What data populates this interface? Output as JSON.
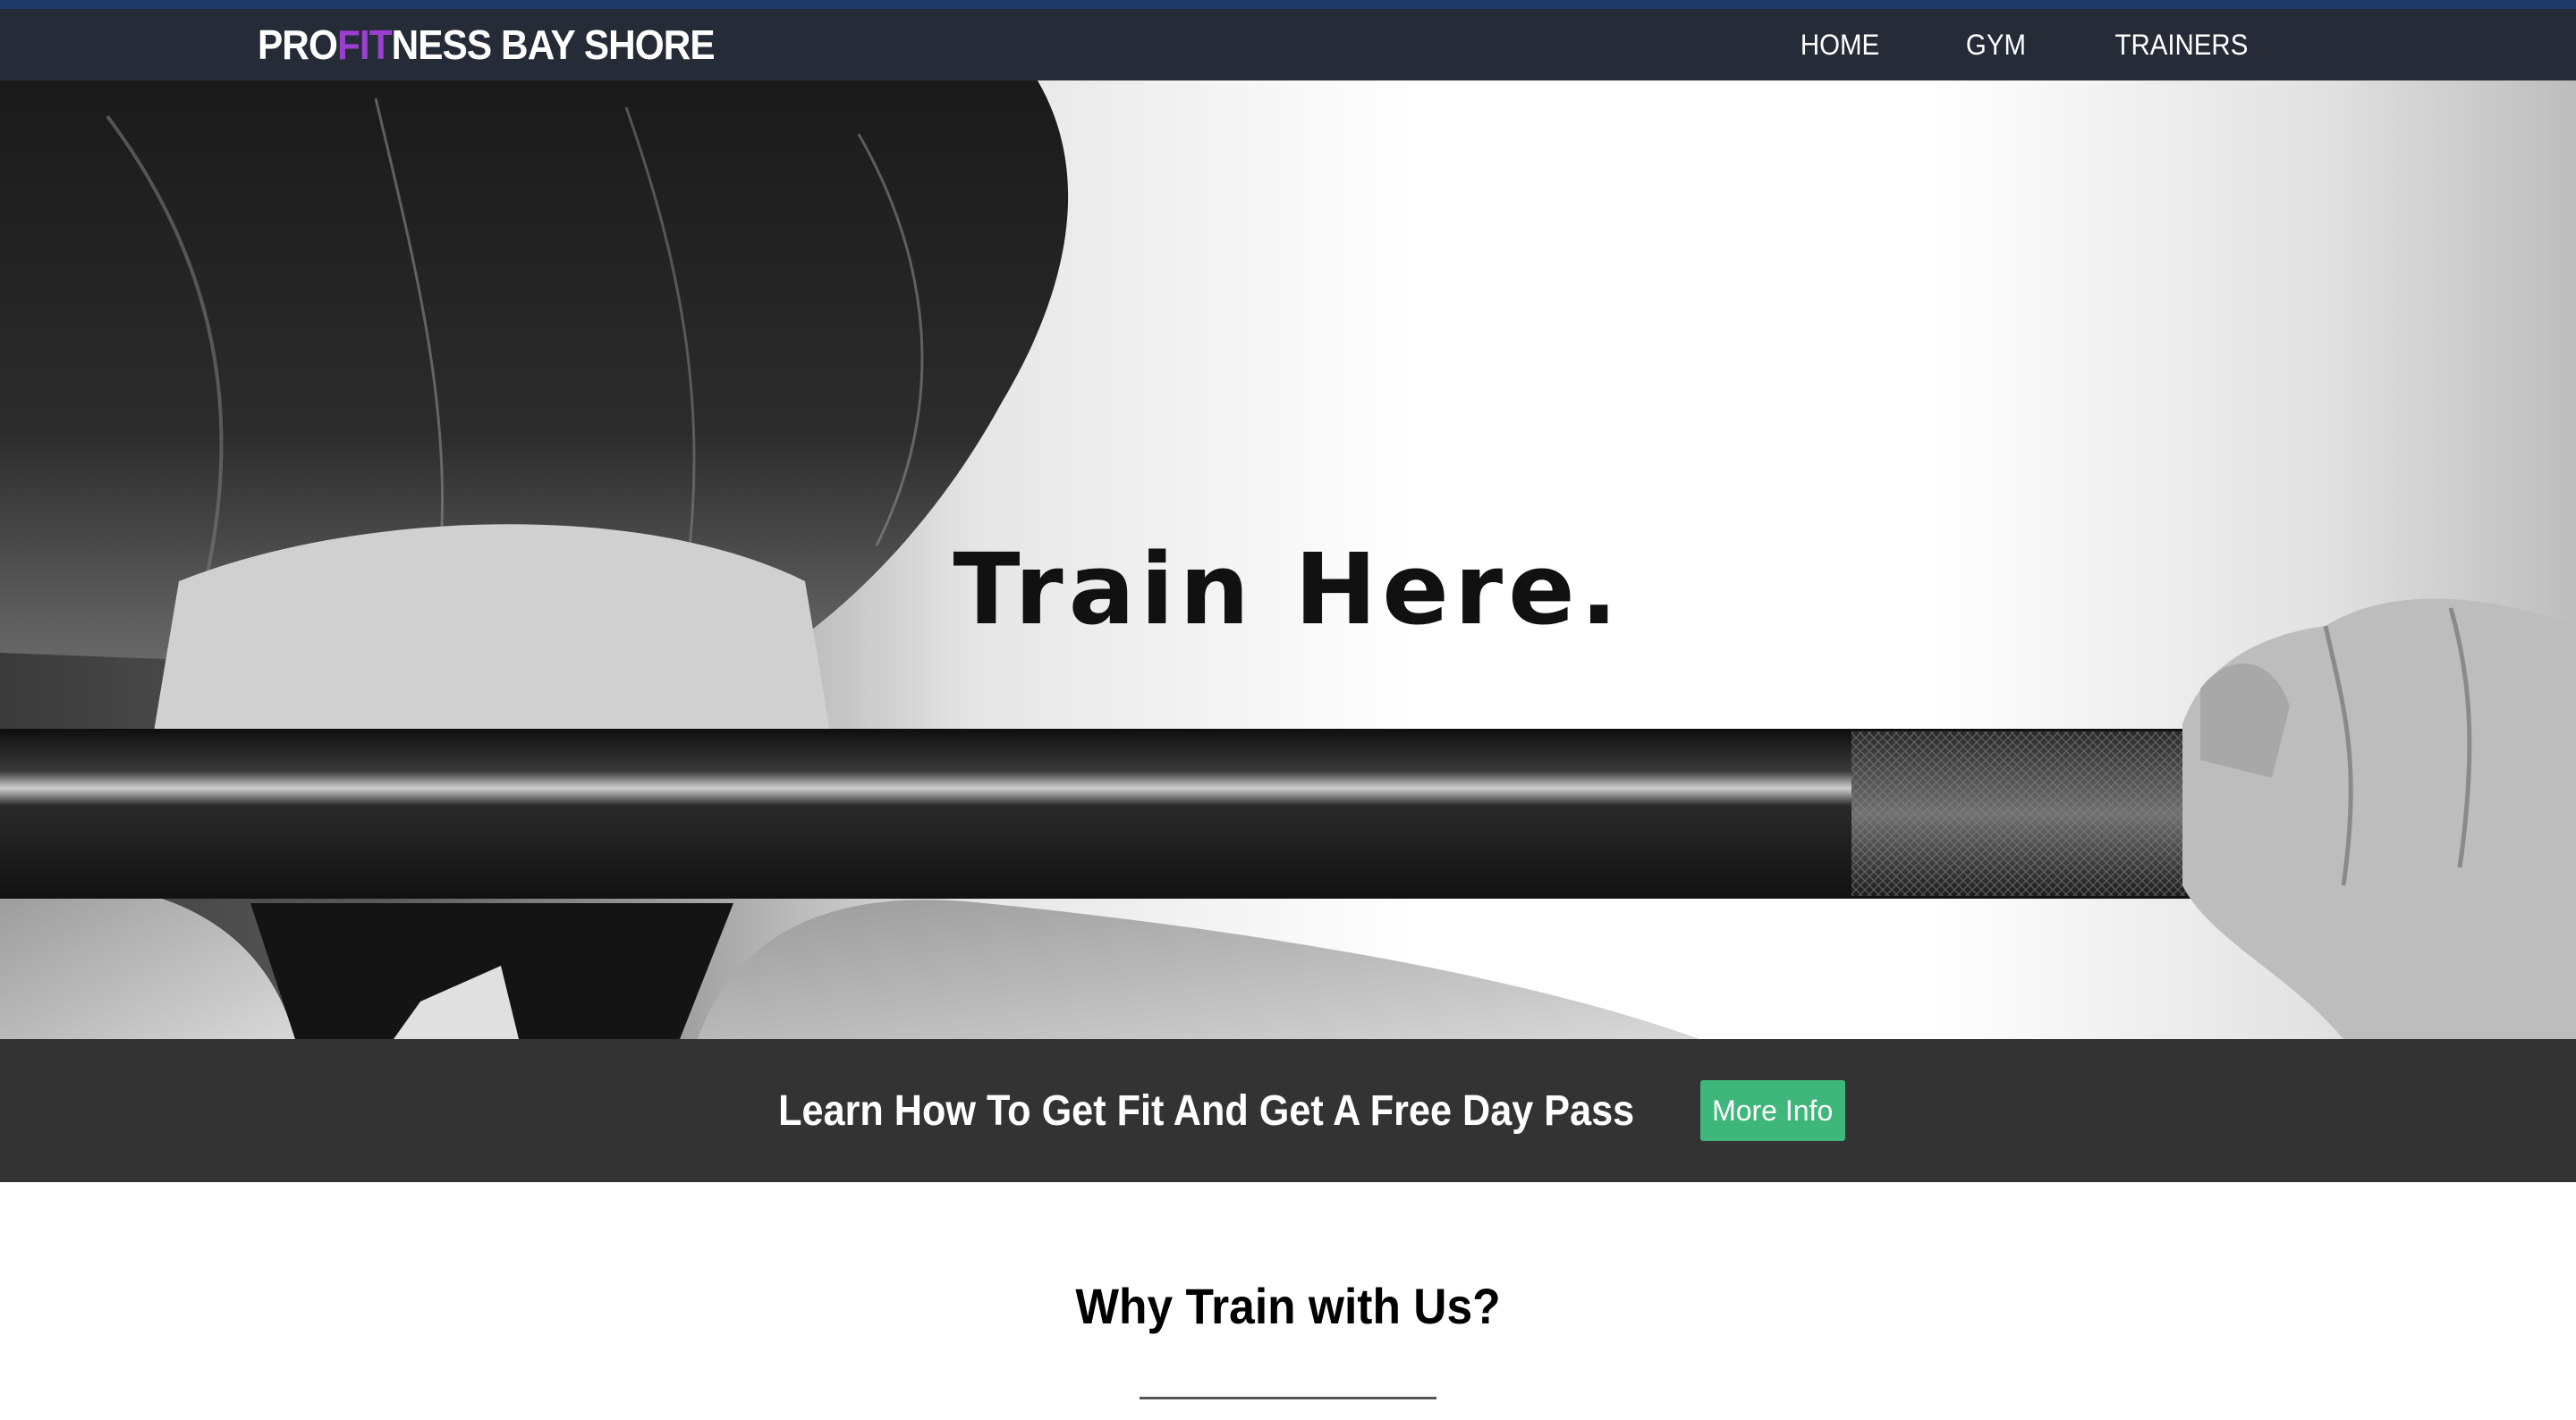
{
  "nav": {
    "brand_prefix": "PRO",
    "brand_accent": "FIT",
    "brand_suffix": "NESS BAY SHORE",
    "links": [
      {
        "label": "HOME"
      },
      {
        "label": "GYM"
      },
      {
        "label": "TRAINERS"
      }
    ]
  },
  "hero": {
    "title": "Train Here."
  },
  "cta": {
    "text": "Learn How To Get Fit And Get A Free Day Pass",
    "button_label": "More Info"
  },
  "section": {
    "title": "Why Train with Us?"
  },
  "colors": {
    "navbar": "#262b38",
    "accent_strip": "#1e3a66",
    "brand_accent": "#9b3fd0",
    "cta_bar": "#333333",
    "cta_button": "#3fb77a"
  }
}
